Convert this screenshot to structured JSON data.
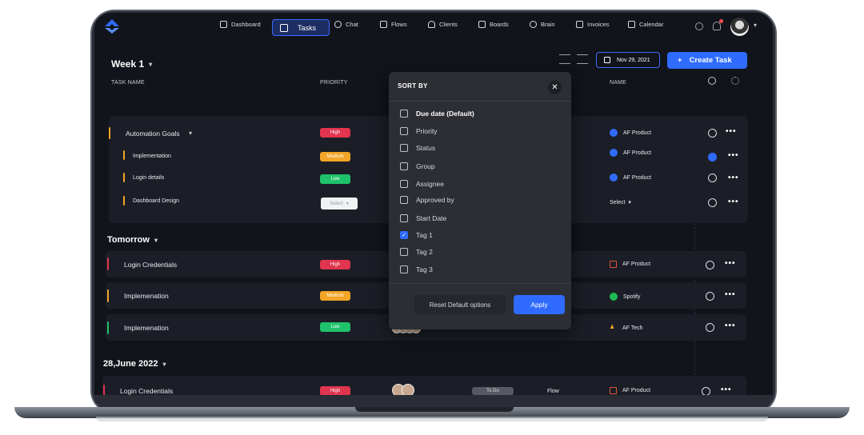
{
  "nav": {
    "items": [
      "Dashboard",
      "Tasks",
      "Chat",
      "Flows",
      "Clients",
      "Boards",
      "Brain",
      "Invoices",
      "Calendar"
    ],
    "active": "Tasks"
  },
  "toolbar": {
    "date": "Nov 29, 2021",
    "create_label": "Create Task"
  },
  "columns": {
    "task_name": "TASK NAME",
    "priority": "PRIORITY",
    "name": "NAME"
  },
  "groups": {
    "week": {
      "title": "Week 1",
      "parent": {
        "name": "Automation  Goals",
        "priority": "High",
        "product": "AF Product"
      },
      "subtasks": [
        {
          "name": "Implementation",
          "priority": "Medium",
          "product": "AF Product",
          "done": true
        },
        {
          "name": "Login details",
          "priority": "Low",
          "product": "AF Product",
          "done": false
        },
        {
          "name": "Dashboard Design",
          "priority": "Select",
          "product": "Select",
          "done": false
        }
      ]
    },
    "tomorrow": {
      "title": "Tomorrow",
      "rows": [
        {
          "name": "Login Credentials",
          "priority": "High",
          "client": "AF Product"
        },
        {
          "name": "Implemenation",
          "priority": "Medium",
          "client": "Spotify"
        },
        {
          "name": "Implemenation",
          "priority": "Low",
          "client": "AF Tech"
        }
      ]
    },
    "june": {
      "title": "28,June 2022",
      "rows": [
        {
          "name": "Login Credentials",
          "priority": "High",
          "status": "To Do",
          "flow": "Flow",
          "client": "AF Product"
        }
      ]
    }
  },
  "sort_modal": {
    "title": "SORT BY",
    "options": [
      {
        "label": "Due date (Default)",
        "checked": false
      },
      {
        "label": "Priority",
        "checked": false
      },
      {
        "label": "Status",
        "checked": false
      },
      {
        "label": "Group",
        "checked": false
      },
      {
        "label": "Assignee",
        "checked": false
      },
      {
        "label": "Approved by",
        "checked": false
      },
      {
        "label": "Start Date",
        "checked": false
      },
      {
        "label": "Tag 1",
        "checked": true
      },
      {
        "label": "Tag 2",
        "checked": false
      },
      {
        "label": "Tag 3",
        "checked": false
      }
    ],
    "reset_label": "Reset Default options",
    "apply_label": "Apply"
  },
  "colors": {
    "accent": "#2f6bff",
    "high": "#e0344f",
    "medium": "#f2a526",
    "low": "#1fc16b",
    "bg": "#12141b"
  }
}
